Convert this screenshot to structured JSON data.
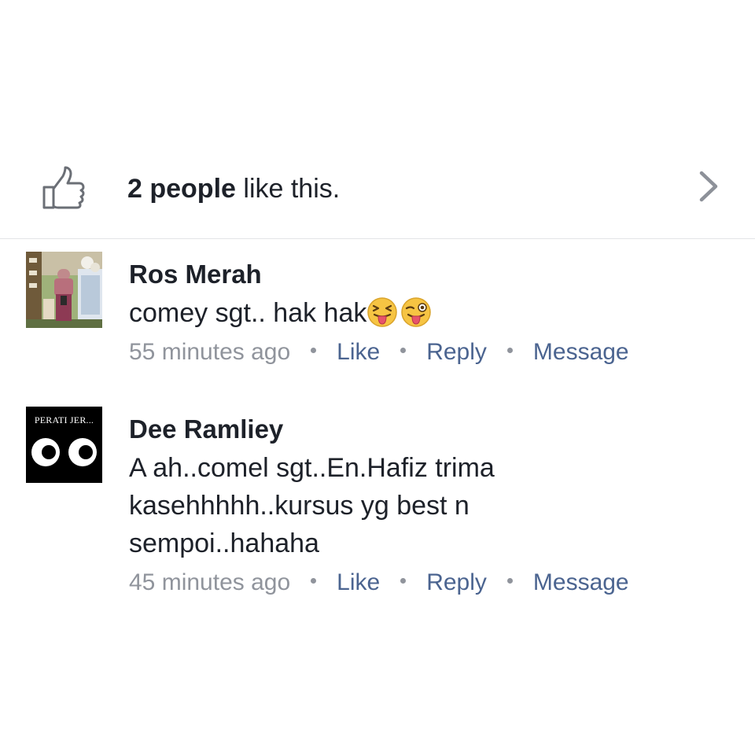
{
  "likes": {
    "count_label": "2 people",
    "suffix": " like this."
  },
  "comments": [
    {
      "author": "Ros Merah",
      "text": "comey sgt.. hak hak",
      "emojis": [
        "squinting-tongue-face-emoji",
        "winking-tongue-face-emoji"
      ],
      "time": "55 minutes ago",
      "actions": [
        "Like",
        "Reply",
        "Message"
      ]
    },
    {
      "author": "Dee Ramliey",
      "text": "A ah..comel sgt..En.Hafiz trima kasehhhhh..kursus yg best n sempoi..hahaha",
      "avatar_text": "PERATI JER...",
      "time": "45 minutes ago",
      "actions": [
        "Like",
        "Reply",
        "Message"
      ]
    }
  ],
  "colors": {
    "text": "#1d2129",
    "meta_gray": "#90949c",
    "action_blue": "#4b6490",
    "divider": "#e2e4e7",
    "icon_gray": "#6b6f76"
  },
  "icons": {
    "like": "thumbs-up-icon",
    "chevron": "chevron-right-icon"
  }
}
